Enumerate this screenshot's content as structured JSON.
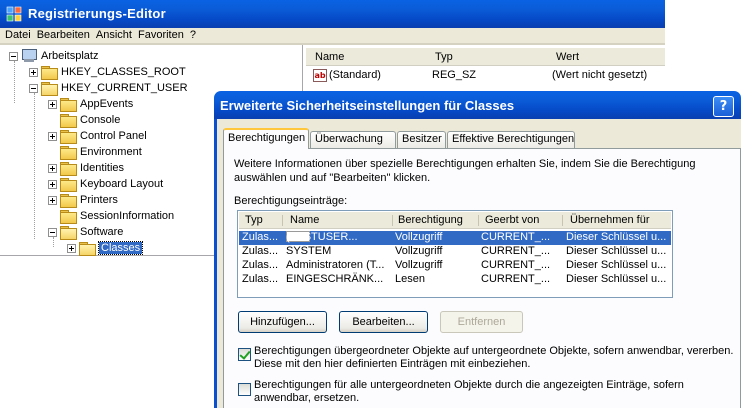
{
  "regedit": {
    "title": "Registrierungs-Editor",
    "menu": [
      "Datei",
      "Bearbeiten",
      "Ansicht",
      "Favoriten",
      "?"
    ],
    "tree": {
      "root": "Arbeitsplatz",
      "hives": [
        "HKEY_CLASSES_ROOT",
        "HKEY_CURRENT_USER"
      ],
      "children": [
        "AppEvents",
        "Console",
        "Control Panel",
        "Environment",
        "Identities",
        "Keyboard Layout",
        "Printers",
        "SessionInformation",
        "Software"
      ],
      "selected": "Classes"
    },
    "list": {
      "columns": [
        "Name",
        "Typ",
        "Wert"
      ],
      "rows": [
        {
          "name": "(Standard)",
          "type": "REG_SZ",
          "value": "(Wert nicht gesetzt)"
        }
      ]
    }
  },
  "dialog": {
    "title": "Erweiterte Sicherheitseinstellungen für Classes",
    "help": "?",
    "tabs": [
      "Berechtigungen",
      "Überwachung",
      "Besitzer",
      "Effektive Berechtigungen"
    ],
    "info": "Weitere Informationen über spezielle Berechtigungen erhalten Sie, indem Sie die Berechtigung auswählen und auf \"Bearbeiten\" klicken.",
    "entries_label": "Berechtigungseinträge:",
    "columns": [
      "Typ",
      "Name",
      "Berechtigung",
      "Geerbt von",
      "Übernehmen für"
    ],
    "entries": [
      {
        "type": "Zulas...",
        "name": "(TESTUSER...",
        "permission": "Vollzugriff",
        "inherited": "CURRENT_...",
        "apply": "Dieser Schlüssel u..."
      },
      {
        "type": "Zulas...",
        "name": "SYSTEM",
        "permission": "Vollzugriff",
        "inherited": "CURRENT_...",
        "apply": "Dieser Schlüssel u..."
      },
      {
        "type": "Zulas...",
        "name": "Administratoren (T...",
        "permission": "Vollzugriff",
        "inherited": "CURRENT_...",
        "apply": "Dieser Schlüssel u..."
      },
      {
        "type": "Zulas...",
        "name": "EINGESCHRÄNK...",
        "permission": "Lesen",
        "inherited": "CURRENT_...",
        "apply": "Dieser Schlüssel u..."
      }
    ],
    "buttons": {
      "add": "Hinzufügen...",
      "edit": "Bearbeiten...",
      "remove": "Entfernen"
    },
    "checkbox1": {
      "line1": "Berechtigungen übergeordneter Objekte auf untergeordnete Objekte, sofern anwendbar, vererben.",
      "line2": "Diese mit den hier definierten Einträgen mit einbeziehen.",
      "checked": true
    },
    "checkbox2": {
      "line1": "Berechtigungen für alle untergeordneten Objekte durch die angezeigten Einträge, sofern",
      "line2": "anwendbar, ersetzen.",
      "checked": false
    }
  }
}
